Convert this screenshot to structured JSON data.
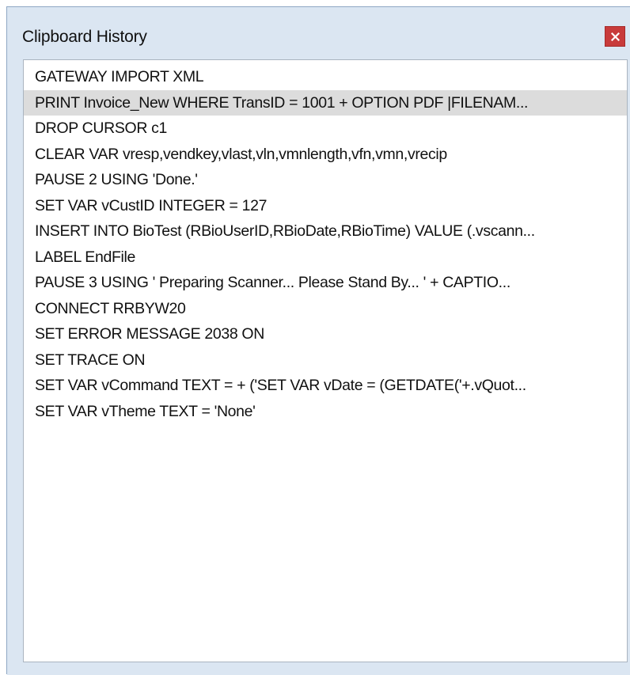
{
  "window": {
    "title": "Clipboard History",
    "close_icon": "close-icon",
    "accent_color": "#c83b3b"
  },
  "history": {
    "selected_index": 1,
    "items": [
      "GATEWAY IMPORT XML",
      "PRINT Invoice_New WHERE TransID = 1001 + OPTION PDF |FILENAM...",
      "DROP CURSOR c1",
      "CLEAR VAR vresp,vendkey,vlast,vln,vmnlength,vfn,vmn,vrecip",
      "PAUSE 2 USING 'Done.'",
      "SET VAR vCustID INTEGER = 127",
      "INSERT INTO BioTest (RBioUserID,RBioDate,RBioTime) VALUE (.vscann...",
      "LABEL EndFile",
      "PAUSE 3 USING '  Preparing Scanner...  Please Stand By...  ' + CAPTIO...",
      "CONNECT RRBYW20",
      "SET ERROR MESSAGE 2038 ON",
      "SET TRACE ON",
      "SET VAR vCommand TEXT = + ('SET VAR vDate = (GETDATE('+.vQuot...",
      "SET VAR vTheme TEXT = 'None'"
    ]
  }
}
